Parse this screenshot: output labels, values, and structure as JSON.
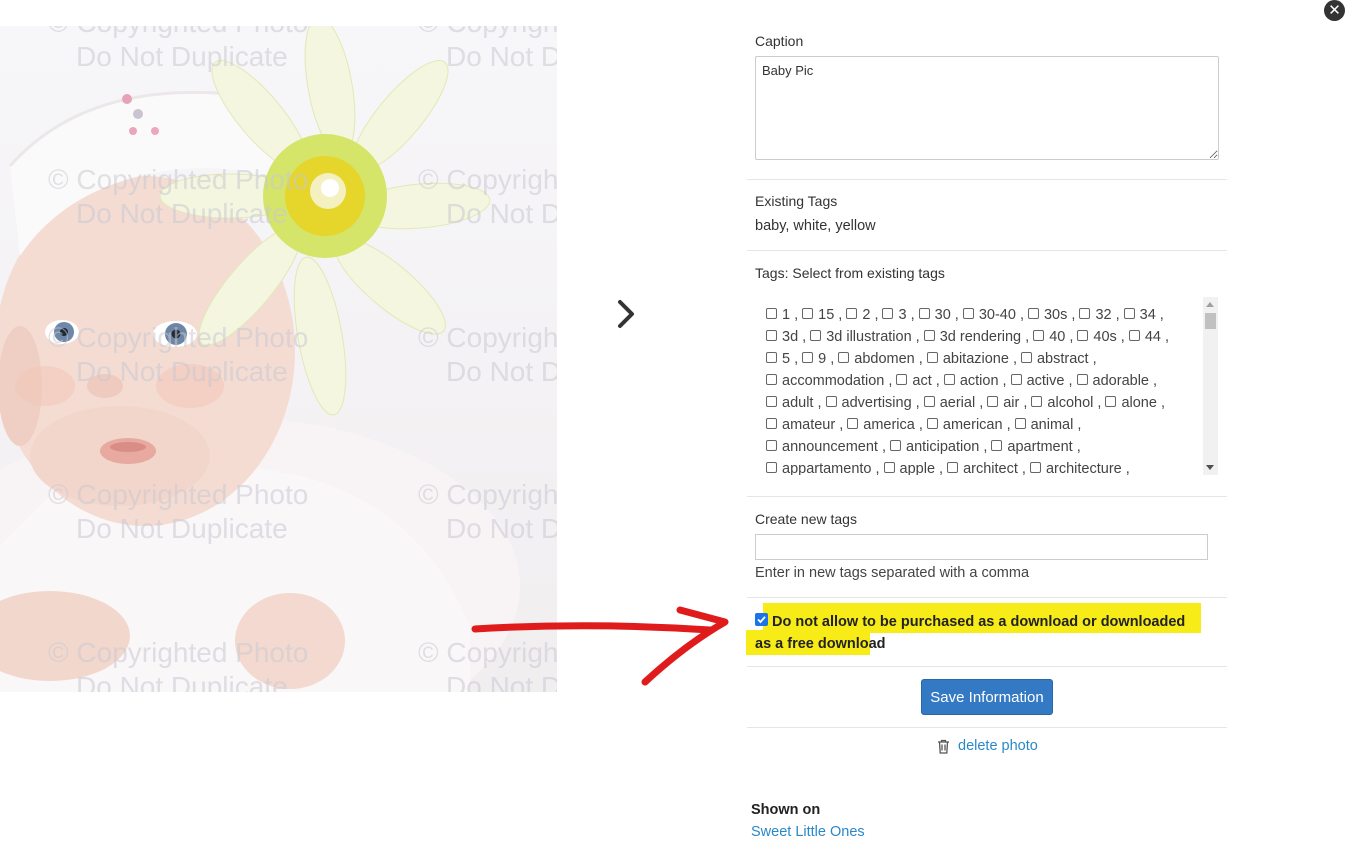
{
  "close": {
    "icon": "close-circle-icon",
    "glyph": "✕"
  },
  "photo": {
    "watermark_line1": "© Copyrighted Photo",
    "watermark_line2": "Do Not Duplicate"
  },
  "nav": {
    "next_icon": "chevron-right-icon"
  },
  "caption": {
    "label": "Caption",
    "value": "Baby Pic"
  },
  "existing_tags": {
    "label": "Existing Tags",
    "value": "baby, white, yellow"
  },
  "tag_select": {
    "label": "Tags: Select from existing tags",
    "lines": [
      [
        "1",
        "15",
        "2",
        "3",
        "30",
        "30-40",
        "30s",
        "32",
        "34"
      ],
      [
        "3d",
        "3d illustration",
        "3d rendering",
        "40",
        "40s",
        "44"
      ],
      [
        "5",
        "9",
        "abdomen",
        "abitazione",
        "abstract"
      ],
      [
        "accommodation",
        "act",
        "action",
        "active",
        "adorable"
      ],
      [
        "adult",
        "advertising",
        "aerial",
        "air",
        "alcohol",
        "alone"
      ],
      [
        "amateur",
        "america",
        "american",
        "animal"
      ],
      [
        "announcement",
        "anticipation",
        "apartment"
      ],
      [
        "appartamento",
        "apple",
        "architect",
        "architecture"
      ]
    ]
  },
  "new_tags": {
    "label": "Create new tags",
    "value": "",
    "hint": "Enter in new tags separated with a comma"
  },
  "download_option": {
    "checked": true,
    "label": "Do not allow to be purchased as a download or downloaded as a free download"
  },
  "save_button": {
    "label": "Save Information"
  },
  "delete": {
    "icon": "trash-icon",
    "label": "delete photo"
  },
  "shown_on": {
    "label": "Shown on",
    "gallery": "Sweet Little Ones"
  },
  "colors": {
    "highlight": "#f7ec17",
    "arrow": "#e01b1b",
    "button": "#3379c4",
    "link": "#2b88c8"
  }
}
